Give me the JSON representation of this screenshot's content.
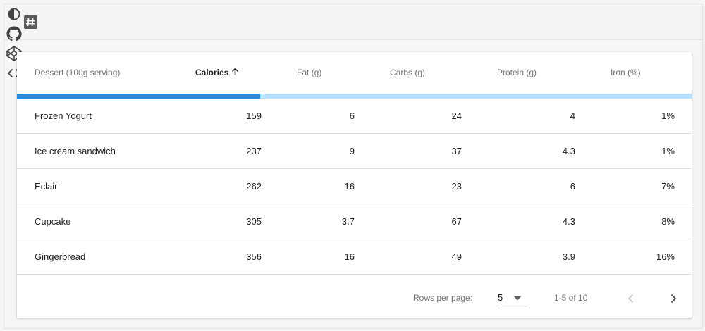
{
  "toolbar": {
    "logo_icon": "hash-square-icon",
    "actions": [
      {
        "icon": "contrast-icon"
      },
      {
        "icon": "github-icon"
      },
      {
        "icon": "codepen-icon"
      },
      {
        "icon": "code-icon"
      }
    ]
  },
  "table": {
    "headers": [
      "Dessert (100g serving)",
      "Calories",
      "Fat (g)",
      "Carbs (g)",
      "Protein (g)",
      "Iron (%)"
    ],
    "sorted_column": "Calories",
    "sort_direction": "ascending",
    "loading_progress_percent": 36,
    "rows": [
      {
        "name": "Frozen Yogurt",
        "calories": "159",
        "fat": "6",
        "carbs": "24",
        "protein": "4",
        "iron": "1%"
      },
      {
        "name": "Ice cream sandwich",
        "calories": "237",
        "fat": "9",
        "carbs": "37",
        "protein": "4.3",
        "iron": "1%"
      },
      {
        "name": "Eclair",
        "calories": "262",
        "fat": "16",
        "carbs": "23",
        "protein": "6",
        "iron": "7%"
      },
      {
        "name": "Cupcake",
        "calories": "305",
        "fat": "3.7",
        "carbs": "67",
        "protein": "4.3",
        "iron": "8%"
      },
      {
        "name": "Gingerbread",
        "calories": "356",
        "fat": "16",
        "carbs": "49",
        "protein": "3.9",
        "iron": "16%"
      }
    ]
  },
  "pagination": {
    "rows_per_page_label": "Rows per page:",
    "rows_per_page_value": "5",
    "range_text": "1-5 of 10"
  },
  "colors": {
    "accent": "#2a89e0",
    "progress_track": "#bbdefb"
  }
}
